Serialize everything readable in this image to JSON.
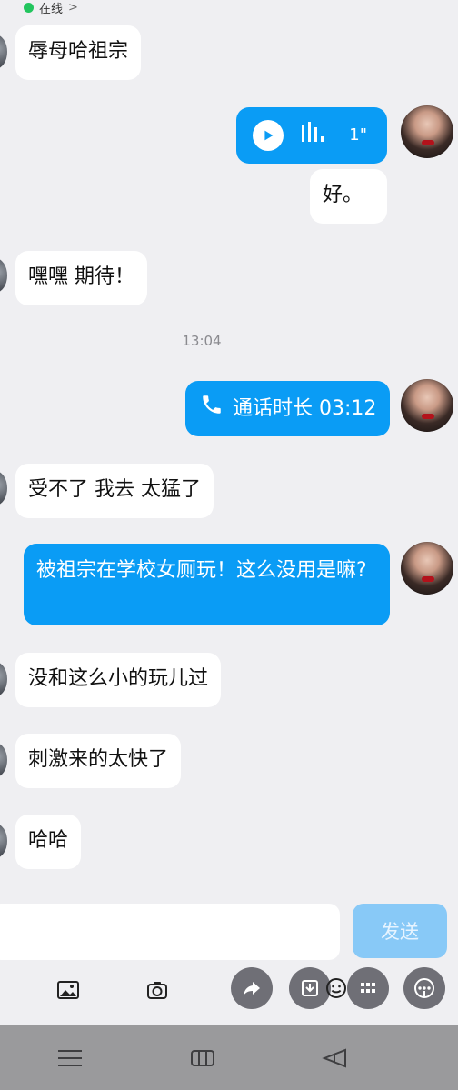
{
  "status": {
    "presence": "在线",
    "chevron": ">"
  },
  "messages": [
    {
      "dir": "in",
      "text": "辱母哈祖宗"
    },
    {
      "dir": "out",
      "type": "voice",
      "duration": "1\""
    },
    {
      "dir": "out",
      "type": "text_white",
      "text": "好。"
    },
    {
      "dir": "in",
      "text": "嘿嘿 期待！"
    },
    {
      "type": "time",
      "text": "13:04"
    },
    {
      "dir": "out",
      "type": "call",
      "text": "通话时长 03:12"
    },
    {
      "dir": "in",
      "text": "受不了 我去 太猛了"
    },
    {
      "dir": "out",
      "text": "被祖宗在学校女厕玩！这么没用是嘛?"
    },
    {
      "dir": "in",
      "text": "没和这么小的玩儿过"
    },
    {
      "dir": "in",
      "text": "刺激来的太快了"
    },
    {
      "dir": "in",
      "text": "哈哈"
    }
  ],
  "composer": {
    "send_label": "发送",
    "placeholder": ""
  },
  "toolbar": {
    "icons": [
      "image-icon",
      "camera-icon",
      "share-icon",
      "download-icon",
      "emoji-icon",
      "apps-icon",
      "more-icon"
    ]
  },
  "nav": {
    "icons": [
      "menu-icon",
      "home-icon",
      "back-icon"
    ]
  },
  "colors": {
    "accent": "#0a9cf5",
    "send_bg": "#88c9f7",
    "bg": "#efeff2"
  }
}
